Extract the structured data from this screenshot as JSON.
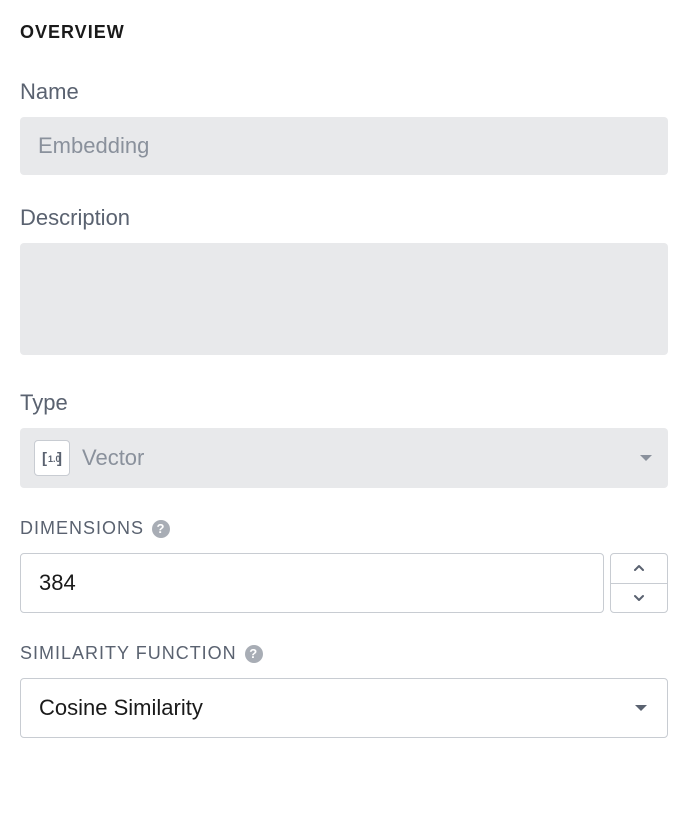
{
  "section": {
    "title": "OVERVIEW"
  },
  "name_field": {
    "label": "Name",
    "placeholder": "Embedding",
    "value": ""
  },
  "description_field": {
    "label": "Description",
    "value": ""
  },
  "type_field": {
    "label": "Type",
    "value": "Vector",
    "icon_text": "[1.0]"
  },
  "dimensions_field": {
    "label": "DIMENSIONS",
    "value": "384"
  },
  "similarity_field": {
    "label": "SIMILARITY FUNCTION",
    "value": "Cosine Similarity"
  }
}
